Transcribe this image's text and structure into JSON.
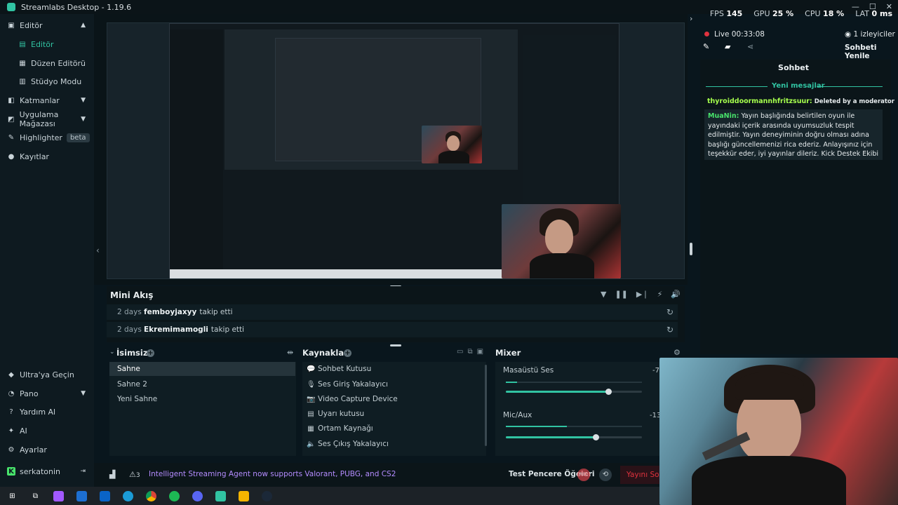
{
  "window": {
    "title": "Streamlabs Desktop - 1.19.6"
  },
  "stats": {
    "fps_label": "FPS",
    "fps": "145",
    "gpu_label": "GPU",
    "gpu": "25 %",
    "cpu_label": "CPU",
    "cpu": "18 %",
    "lat_label": "LAT",
    "lat": "0 ms"
  },
  "sidebar": {
    "items": [
      {
        "label": "Editör",
        "icon": "editor-icon"
      },
      {
        "label": "Editör",
        "icon": "editor-icon"
      },
      {
        "label": "Düzen Editörü",
        "icon": "layout-icon"
      },
      {
        "label": "Stüdyo Modu",
        "icon": "studio-icon"
      },
      {
        "label": "Katmanlar",
        "icon": "layers-icon"
      },
      {
        "label": "Uygulama Mağazası",
        "icon": "store-icon"
      },
      {
        "label": "Highlighter",
        "icon": "highlighter-icon",
        "badge": "beta"
      },
      {
        "label": "Kayıtlar",
        "icon": "recordings-icon"
      }
    ],
    "bottom": [
      {
        "label": "Ultra'ya Geçin",
        "icon": "ultra-icon"
      },
      {
        "label": "Pano",
        "icon": "dashboard-icon"
      },
      {
        "label": "Yardım Al",
        "icon": "help-icon"
      },
      {
        "label": "AI",
        "icon": "ai-icon"
      },
      {
        "label": "Ayarlar",
        "icon": "settings-icon"
      },
      {
        "label": "serkatonin",
        "icon": "kick-icon"
      }
    ]
  },
  "mini_feed": {
    "title": "Mini Akış",
    "rows": [
      {
        "time": "2 days",
        "user": "femboyjaxyy",
        "action": "takip etti"
      },
      {
        "time": "2 days",
        "user": "Ekremimamogli",
        "action": "takip etti"
      }
    ]
  },
  "scenes": {
    "title": "İsimsiz",
    "items": [
      "Sahne",
      "Sahne 2",
      "Yeni Sahne"
    ]
  },
  "sources": {
    "title": "Kaynaklar",
    "items": [
      "Sohbet Kutusu",
      "Ses Giriş Yakalayıcı",
      "Video Capture Device",
      "Uyarı kutusu",
      "Ortam Kaynağı",
      "Ses Çıkış Yakalayıcı"
    ]
  },
  "mixer": {
    "title": "Mixer",
    "channels": [
      {
        "name": "Masaüstü Ses",
        "db": "-7.",
        "level": 0.08,
        "volume": 0.75
      },
      {
        "name": "Mic/Aux",
        "db": "-13.",
        "level": 0.45,
        "volume": 0.66
      }
    ]
  },
  "footer": {
    "notice": "Intelligent Streaming Agent now supports Valorant, PUBG, and CS2",
    "notice_count": "3",
    "test_label": "Test Pencere Öğeleri",
    "rec_label": "REC",
    "golive_label": "Yayını Sonlandır"
  },
  "chat": {
    "live_label": "Live 00:33:08",
    "viewers": "1 izleyiciler",
    "refresh_label": "Sohbeti Yenile",
    "title": "Sohbet",
    "new_messages": "Yeni mesajlar",
    "deleted_user": "thyroiddoormannhfritzsuur:",
    "deleted_text": "Deleted by a moderator",
    "mod_name": "MuaNin:",
    "mod_text": "Yayın başlığında belirtilen oyun ile yayındaki içerik arasında uyumsuzluk tespit edilmiştir. Yayın deneyiminin doğru olması adına başlığı güncellemenizi rica ederiz. Anlayışınız için teşekkür eder, iyi yayınlar dileriz. Kick Destek Ekibi"
  },
  "colors": {
    "accent": "#31c3a2",
    "live": "#e0323e",
    "notice": "#b48cff",
    "kick_green": "#48e36b"
  }
}
